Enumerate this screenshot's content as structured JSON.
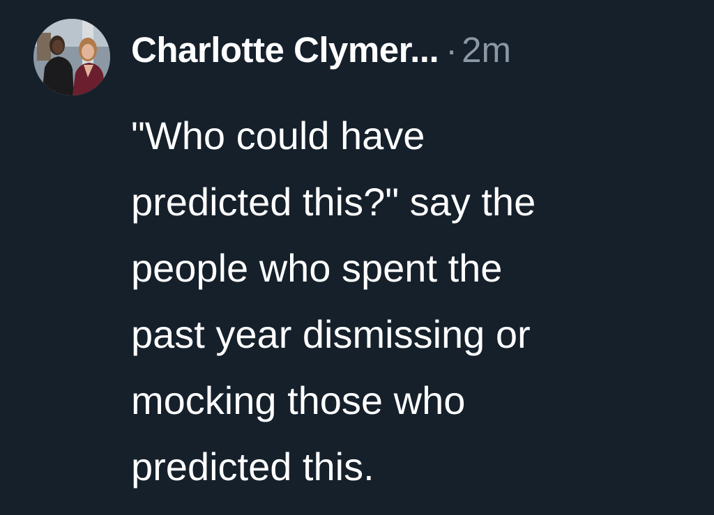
{
  "tweet": {
    "author_name": "Charlotte Clymer...",
    "separator": "·",
    "timestamp": "2m",
    "text_lines": [
      "\"Who could have",
      "predicted this?\" say the",
      "people who spent the",
      "past year dismissing or",
      "mocking those who",
      "predicted this."
    ]
  },
  "colors": {
    "background": "#15202b",
    "text": "#ffffff",
    "secondary_text": "#8b98a5"
  }
}
